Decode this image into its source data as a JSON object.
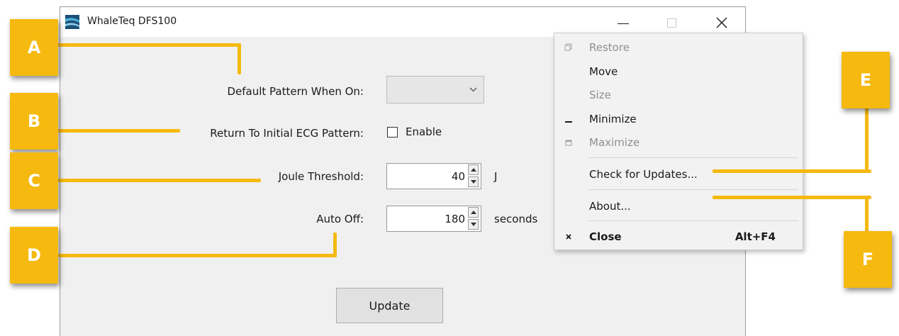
{
  "window": {
    "title": "WhaleTeq DFS100",
    "controls": {
      "minimize": "—",
      "maximize": "□",
      "close": "✕"
    }
  },
  "form": {
    "default_pattern": {
      "label": "Default Pattern When On:",
      "value": ""
    },
    "return_initial": {
      "label": "Return To Initial ECG Pattern:",
      "checkbox_label": "Enable",
      "checked": false
    },
    "joule_threshold": {
      "label": "Joule Threshold:",
      "value": "40",
      "unit": "J"
    },
    "auto_off": {
      "label": "Auto Off:",
      "value": "180",
      "unit": "seconds"
    },
    "update_button": "Update"
  },
  "system_menu": {
    "items": [
      {
        "label": "Restore",
        "enabled": false,
        "icon": "restore-icon"
      },
      {
        "label": "Move",
        "enabled": true
      },
      {
        "label": "Size",
        "enabled": false
      },
      {
        "label": "Minimize",
        "enabled": true,
        "icon": "minimize-icon"
      },
      {
        "label": "Maximize",
        "enabled": false,
        "icon": "maximize-icon"
      },
      {
        "label": "Check for Updates...",
        "enabled": true
      },
      {
        "label": "About...",
        "enabled": true
      },
      {
        "label": "Close",
        "enabled": true,
        "icon": "close-icon",
        "shortcut": "Alt+F4"
      }
    ]
  },
  "callouts": [
    "A",
    "B",
    "C",
    "D",
    "E",
    "F"
  ],
  "colors": {
    "callout": "#f5b90f",
    "window_bg": "#f0f0f0",
    "menu_bg": "#f2f2f2"
  }
}
